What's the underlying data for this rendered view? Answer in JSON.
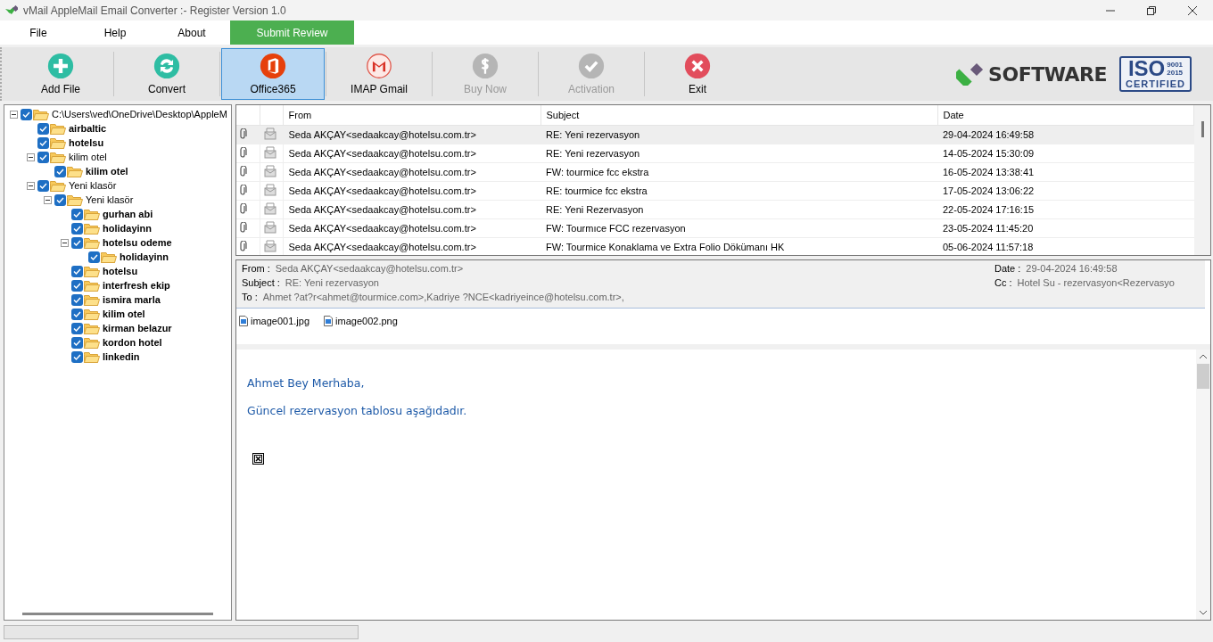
{
  "window": {
    "title": "vMail AppleMail Email Converter :- Register Version 1.0"
  },
  "menu": [
    {
      "label": "File",
      "kind": "plain"
    },
    {
      "label": "Help",
      "kind": "plain"
    },
    {
      "label": "About",
      "kind": "plain"
    },
    {
      "label": "Submit Review",
      "kind": "accent"
    }
  ],
  "toolbar": [
    {
      "label": "Add File",
      "kind": "add",
      "disabled": false,
      "selected": false
    },
    {
      "label": "Convert",
      "kind": "convert",
      "disabled": false,
      "selected": false
    },
    {
      "label": "Office365",
      "kind": "office",
      "disabled": false,
      "selected": true
    },
    {
      "label": "IMAP Gmail",
      "kind": "gmail",
      "disabled": false,
      "selected": false
    },
    {
      "label": "Buy Now",
      "kind": "buy",
      "disabled": true,
      "selected": false
    },
    {
      "label": "Activation",
      "kind": "activate",
      "disabled": true,
      "selected": false
    },
    {
      "label": "Exit",
      "kind": "exit",
      "disabled": false,
      "selected": false
    }
  ],
  "brand": {
    "logo": "SOFTWARE",
    "iso_main": "ISO",
    "iso_nums": "9001\n2015",
    "iso_sub": "CERTIFIED"
  },
  "tree": [
    {
      "label": "C:\\Users\\ved\\OneDrive\\Desktop\\AppleM",
      "checked": true,
      "unread": false,
      "expanded": true,
      "children": [
        {
          "label": "airbaltic",
          "checked": true,
          "unread": true
        },
        {
          "label": "hotelsu",
          "checked": true,
          "unread": true
        },
        {
          "label": "kilim otel",
          "checked": true,
          "unread": false,
          "expanded": true,
          "children": [
            {
              "label": "kilim otel",
              "checked": true,
              "unread": true
            }
          ]
        },
        {
          "label": "Yeni klasör",
          "checked": true,
          "unread": false,
          "expanded": true,
          "children": [
            {
              "label": "Yeni klasör",
              "checked": true,
              "unread": false,
              "expanded": true,
              "children": [
                {
                  "label": "gurhan abi",
                  "checked": true,
                  "unread": true
                },
                {
                  "label": "holidayinn",
                  "checked": true,
                  "unread": true
                },
                {
                  "label": "hotelsu odeme",
                  "checked": true,
                  "unread": true,
                  "expanded": true,
                  "children": [
                    {
                      "label": "holidayinn",
                      "checked": true,
                      "unread": true
                    }
                  ]
                },
                {
                  "label": "hotelsu",
                  "checked": true,
                  "unread": true
                },
                {
                  "label": "interfresh ekip",
                  "checked": true,
                  "unread": true
                },
                {
                  "label": "ismira marla",
                  "checked": true,
                  "unread": true
                },
                {
                  "label": "kilim otel",
                  "checked": true,
                  "unread": true
                },
                {
                  "label": "kirman belazur",
                  "checked": true,
                  "unread": true
                },
                {
                  "label": "kordon hotel",
                  "checked": true,
                  "unread": true
                },
                {
                  "label": "linkedin",
                  "checked": true,
                  "unread": true
                }
              ]
            }
          ]
        }
      ]
    }
  ],
  "mail_list": {
    "columns": [
      "From",
      "Subject",
      "Date"
    ],
    "rows": [
      {
        "from": "Seda AKÇAY<sedaakcay@hotelsu.com.tr>",
        "subject": "RE: Yeni rezervasyon",
        "date": "29-04-2024 16:49:58",
        "selected": true
      },
      {
        "from": "Seda AKÇAY<sedaakcay@hotelsu.com.tr>",
        "subject": "RE: Yeni rezervasyon",
        "date": "14-05-2024 15:30:09",
        "selected": false
      },
      {
        "from": "Seda AKÇAY<sedaakcay@hotelsu.com.tr>",
        "subject": "FW: tourmice fcc ekstra",
        "date": "16-05-2024 13:38:41",
        "selected": false
      },
      {
        "from": "Seda AKÇAY<sedaakcay@hotelsu.com.tr>",
        "subject": "RE: tourmice fcc ekstra",
        "date": "17-05-2024 13:06:22",
        "selected": false
      },
      {
        "from": "Seda AKÇAY<sedaakcay@hotelsu.com.tr>",
        "subject": "RE: Yeni Rezervasyon",
        "date": "22-05-2024 17:16:15",
        "selected": false
      },
      {
        "from": "Seda AKÇAY<sedaakcay@hotelsu.com.tr>",
        "subject": "FW: Tourmıce FCC rezervasyon",
        "date": "23-05-2024 11:45:20",
        "selected": false
      },
      {
        "from": "Seda AKÇAY<sedaakcay@hotelsu.com.tr>",
        "subject": "FW: Tourmice Konaklama ve Extra Folio Dökümanı HK",
        "date": "05-06-2024 11:57:18",
        "selected": false
      }
    ]
  },
  "status": {
    "progress": {
      "level": 0
    }
  },
  "preview": {
    "from_label": "From :",
    "from": "Seda AKÇAY<sedaakcay@hotelsu.com.tr>",
    "subject_label": "Subject :",
    "subject": "RE: Yeni rezervasyon",
    "to_label": "To :",
    "to": "Ahmet ?at?r<ahmet@tourmice.com>,Kadriye ?NCE<kadriyeince@hotelsu.com.tr>,",
    "date_label": "Date :",
    "date": "29-04-2024 16:49:58",
    "cc_label": "Cc :",
    "cc": "Hotel Su - rezervasyon<Rezervasyo",
    "attachments": [
      "image001.jpg",
      "image002.png"
    ],
    "body": [
      "Ahmet Bey Merhaba,",
      "Güncel rezervasyon  tablosu  aşağıdadır."
    ]
  }
}
